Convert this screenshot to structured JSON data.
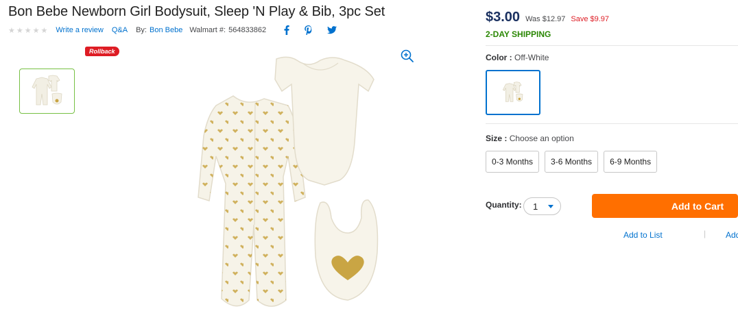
{
  "product": {
    "title": "Bon Bebe Newborn Girl Bodysuit, Sleep 'N Play & Bib, 3pc Set",
    "write_review": "Write a review",
    "qa": "Q&A",
    "by_label": "By:",
    "brand": "Bon Bebe",
    "walmart_label": "Walmart #:",
    "walmart_number": "564833862",
    "rating_stars": 0,
    "badge": "Rollback"
  },
  "share": {
    "icons": [
      "facebook-icon",
      "pinterest-icon",
      "twitter-icon"
    ]
  },
  "pricing": {
    "price": "$3.00",
    "was": "Was $12.97",
    "save": "Save $9.97",
    "shipping": "2-DAY SHIPPING"
  },
  "color": {
    "label": "Color :",
    "value": "Off-White"
  },
  "size": {
    "label": "Size :",
    "value": "Choose an option",
    "options": [
      "0-3 Months",
      "3-6 Months",
      "6-9 Months"
    ]
  },
  "quantity": {
    "label": "Quantity:",
    "value": "1"
  },
  "actions": {
    "add_to_cart": "Add to Cart",
    "add_to_list": "Add to List",
    "add_more": "Add"
  },
  "colors": {
    "brand_blue": "#0071ce",
    "price_navy": "#1a3060",
    "save_red": "#de1c24",
    "shipping_green": "#2a8703",
    "cart_orange": "#ff6f00"
  }
}
